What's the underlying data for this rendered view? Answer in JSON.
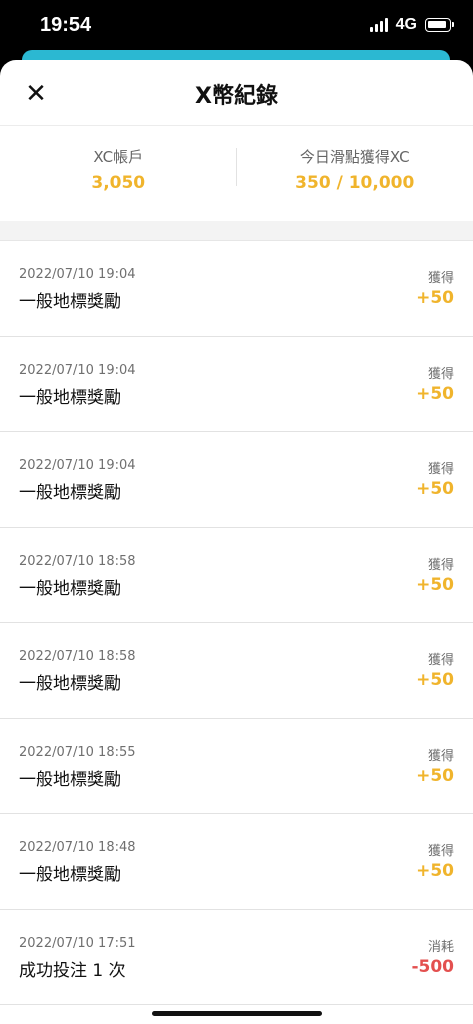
{
  "status_bar": {
    "time": "19:54",
    "network": "4G"
  },
  "header": {
    "title": "X幣紀錄",
    "close_icon": "✕"
  },
  "summary": {
    "left": {
      "label": "XC帳戶",
      "value": "3,050"
    },
    "right": {
      "label": "今日滑點獲得XC",
      "value": "350 / 10,000"
    }
  },
  "records": [
    {
      "date": "2022/07/10 19:04",
      "title": "一般地標獎勵",
      "type": "獲得",
      "amount": "+50"
    },
    {
      "date": "2022/07/10 19:04",
      "title": "一般地標獎勵",
      "type": "獲得",
      "amount": "+50"
    },
    {
      "date": "2022/07/10 19:04",
      "title": "一般地標獎勵",
      "type": "獲得",
      "amount": "+50"
    },
    {
      "date": "2022/07/10 18:58",
      "title": "一般地標獎勵",
      "type": "獲得",
      "amount": "+50"
    },
    {
      "date": "2022/07/10 18:58",
      "title": "一般地標獎勵",
      "type": "獲得",
      "amount": "+50"
    },
    {
      "date": "2022/07/10 18:55",
      "title": "一般地標獎勵",
      "type": "獲得",
      "amount": "+50"
    },
    {
      "date": "2022/07/10 18:48",
      "title": "一般地標獎勵",
      "type": "獲得",
      "amount": "+50"
    },
    {
      "date": "2022/07/10 17:51",
      "title": "成功投注 1 次",
      "type": "消耗",
      "amount": "-500"
    }
  ],
  "colors": {
    "gain": "#f0b42c",
    "spend": "#e3504f",
    "accent": "#2bb8d2"
  }
}
